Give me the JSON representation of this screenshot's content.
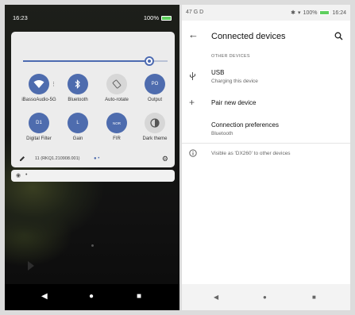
{
  "left": {
    "status": {
      "time": "16:23",
      "battery": "100%"
    },
    "tiles": [
      {
        "glyph": "",
        "label": "iBassoAudio-5G",
        "icon": "wifi-icon",
        "on": true
      },
      {
        "glyph": "",
        "label": "Bluetooth",
        "icon": "bluetooth-icon",
        "on": true
      },
      {
        "glyph": "",
        "label": "Auto-rotate",
        "icon": "rotate-icon",
        "on": false
      },
      {
        "glyph": "PO",
        "label": "Output",
        "icon": "output-icon",
        "on": true
      },
      {
        "glyph": "D1",
        "label": "Digital Filter",
        "icon": "digital-filter-icon",
        "on": true
      },
      {
        "glyph": "L",
        "label": "Gain",
        "icon": "gain-icon",
        "on": true
      },
      {
        "glyph": "NOR",
        "label": "FIR",
        "icon": "fir-icon",
        "on": true
      },
      {
        "glyph": "",
        "label": "Dark theme",
        "icon": "dark-theme-icon",
        "on": false
      }
    ],
    "build": "11 (RKQ1.210908.001)",
    "brightness": 0.85
  },
  "right": {
    "status": {
      "left": "47 G D",
      "battery": "100%",
      "time": "16:24"
    },
    "title": "Connected devices",
    "section": "OTHER DEVICES",
    "usb": {
      "title": "USB",
      "subtitle": "Charging this device"
    },
    "pair": "Pair new device",
    "prefs": {
      "title": "Connection preferences",
      "subtitle": "Bluetooth"
    },
    "visible": "Visible as 'DX260' to other devices"
  },
  "colors": {
    "accent": "#4e6cae",
    "battery": "#5fcf5f"
  }
}
